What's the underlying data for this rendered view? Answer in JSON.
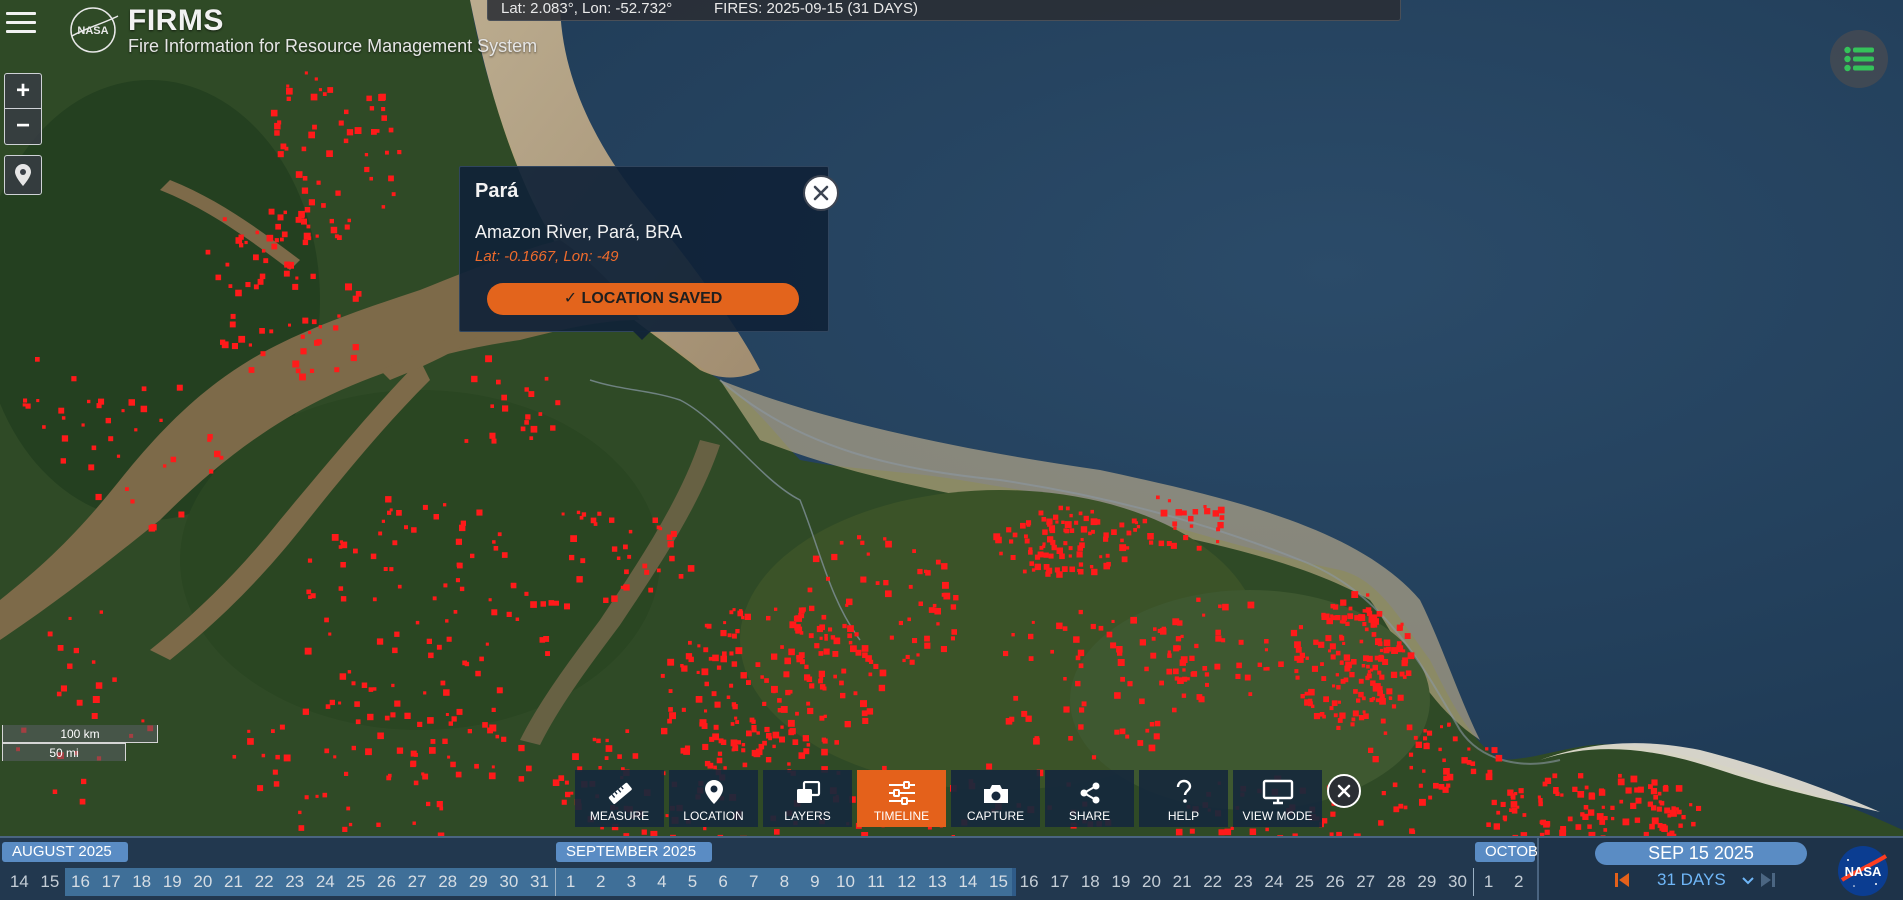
{
  "header": {
    "brand_title": "FIRMS",
    "brand_subtitle": "Fire Information for Resource Management System",
    "logo_text": "NASA"
  },
  "infobar": {
    "coords": "Lat: 2.083°, Lon: -52.732°",
    "fires": "FIRES: 2025-09-15 (31 DAYS)"
  },
  "zoom": {
    "in": "+",
    "out": "−"
  },
  "popup": {
    "title": "Pará",
    "place": "Amazon River, Pará, BRA",
    "coords": "Lat: -0.1667, Lon: -49",
    "saved_label": "LOCATION SAVED"
  },
  "scale": {
    "km": "100 km",
    "mi": "50 mi"
  },
  "toolbar": [
    {
      "label": "MEASURE",
      "icon": "ruler-icon",
      "active": false
    },
    {
      "label": "LOCATION",
      "icon": "location-pin-icon",
      "active": false
    },
    {
      "label": "LAYERS",
      "icon": "layers-icon",
      "active": false
    },
    {
      "label": "TIMELINE",
      "icon": "sliders-icon",
      "active": true
    },
    {
      "label": "CAPTURE",
      "icon": "camera-icon",
      "active": false
    },
    {
      "label": "SHARE",
      "icon": "share-icon",
      "active": false
    },
    {
      "label": "HELP",
      "icon": "help-icon",
      "active": false
    },
    {
      "label": "VIEW MODE",
      "icon": "monitor-icon",
      "active": false
    }
  ],
  "timeline": {
    "months": [
      "AUGUST 2025",
      "SEPTEMBER 2025",
      "OCTOBE"
    ],
    "days_aug": [
      "14",
      "15",
      "16",
      "17",
      "18",
      "19",
      "20",
      "21",
      "22",
      "23",
      "24",
      "25",
      "26",
      "27",
      "28",
      "29",
      "30",
      "31"
    ],
    "days_sep": [
      "1",
      "2",
      "3",
      "4",
      "5",
      "6",
      "7",
      "8",
      "9",
      "10",
      "11",
      "12",
      "13",
      "14",
      "15",
      "16",
      "17",
      "18",
      "19",
      "20",
      "21",
      "22",
      "23",
      "24",
      "25",
      "26",
      "27",
      "28",
      "29",
      "30"
    ],
    "days_oct": [
      "1",
      "2"
    ],
    "selected_date": "SEP 15 2025",
    "range_label": "31 DAYS"
  },
  "colors": {
    "accent_orange": "#e4611b",
    "fire_red": "#ff1a1a",
    "timeline_blue": "#5a8cc4"
  }
}
